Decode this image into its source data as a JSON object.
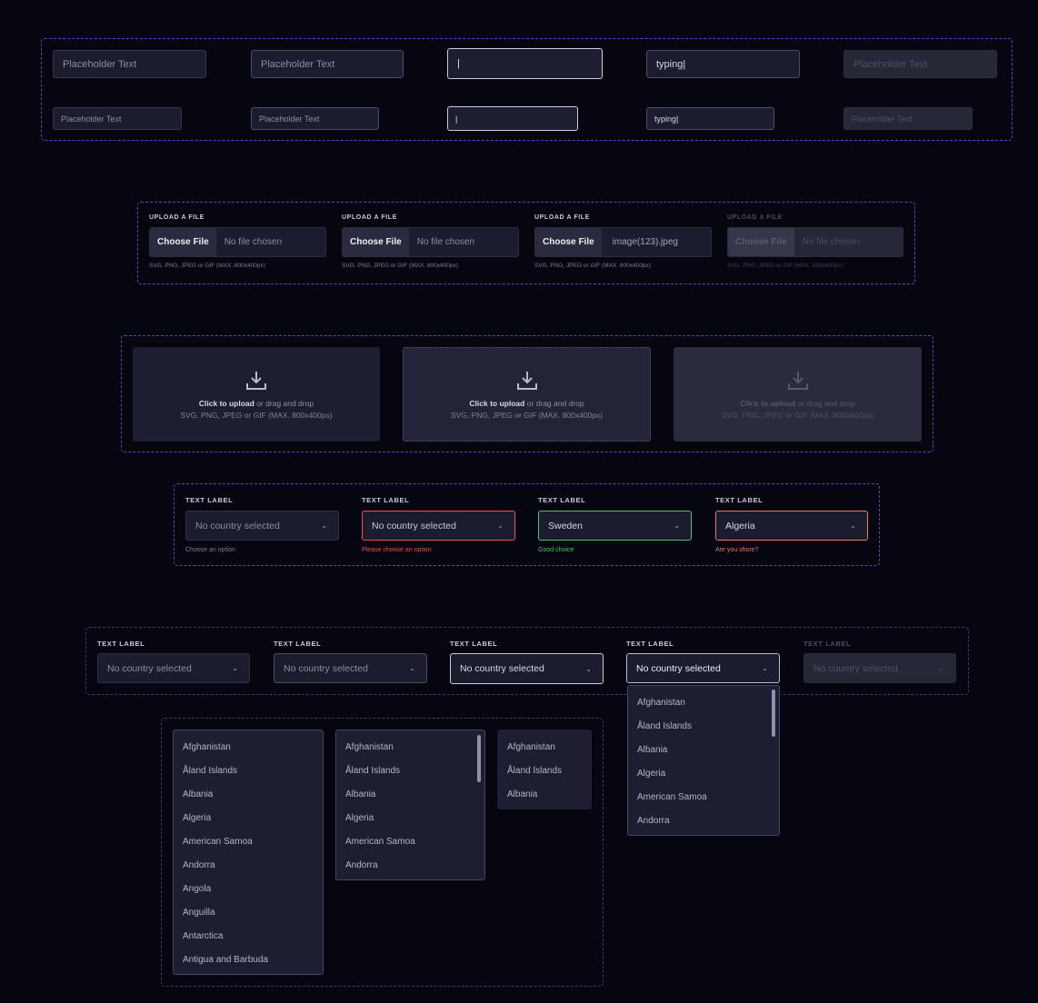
{
  "text_inputs": {
    "large": [
      {
        "value": "Placeholder Text",
        "state": "default"
      },
      {
        "value": "Placeholder Text",
        "state": "bordered"
      },
      {
        "value": "|",
        "state": "focus"
      },
      {
        "value": "typing|",
        "state": "typing"
      },
      {
        "value": "Placeholder Text",
        "state": "disabled"
      }
    ],
    "small": [
      {
        "value": "Placeholder Text",
        "state": "default"
      },
      {
        "value": "Placeholder Text",
        "state": "bordered"
      },
      {
        "value": "|",
        "state": "focus"
      },
      {
        "value": "typing|",
        "state": "typing"
      },
      {
        "value": "Placeholder Text",
        "state": "disabled"
      }
    ]
  },
  "file_uploads": [
    {
      "label": "UPLOAD A FILE",
      "button": "Choose File",
      "file": "No file chosen",
      "hint": "SVG, PNG, JPEG or GIF (MAX. 800x400px)"
    },
    {
      "label": "UPLOAD A FILE",
      "button": "Choose File",
      "file": "No file chosen",
      "hint": "SVG, PNG, JPEG or GIF (MAX. 800x400px)"
    },
    {
      "label": "UPLOAD A FILE",
      "button": "Choose File",
      "file": "image(123).jpeg",
      "hint": "SVG, PNG, JPEG or GIF (MAX. 800x400px)"
    },
    {
      "label": "UPLOAD A FILE",
      "button": "Choose File",
      "file": "No file chosen",
      "hint": "SVG, PNG, JPEG or GIF (MAX. 800x400px)"
    }
  ],
  "dropzones": [
    {
      "strong": "Click to upload",
      "rest": " or drag and drop",
      "hint": "SVG, PNG, JPEG or GIF (MAX. 800x400px)"
    },
    {
      "strong": "Click to upload",
      "rest": " or drag and drop",
      "hint": "SVG, PNG, JPEG or GIF (MAX. 800x400px)"
    },
    {
      "strong": "Click to upload",
      "rest": " or drag and drop",
      "hint": "SVG, PNG, JPEG or GIF (MAX. 800x400px)"
    }
  ],
  "validated_selects": [
    {
      "label": "TEXT LABEL",
      "value": "No country selected",
      "help": "Choose an option"
    },
    {
      "label": "TEXT LABEL",
      "value": "No country selected",
      "help": "Please choose an option"
    },
    {
      "label": "TEXT LABEL",
      "value": "Sweden",
      "help": "Good choice"
    },
    {
      "label": "TEXT LABEL",
      "value": "Algeria",
      "help": "Are you shore?"
    }
  ],
  "state_selects": [
    {
      "label": "TEXT LABEL",
      "value": "No country selected"
    },
    {
      "label": "TEXT LABEL",
      "value": "No country selected"
    },
    {
      "label": "TEXT LABEL",
      "value": "No country selected"
    },
    {
      "label": "TEXT LABEL",
      "value": "No country selected"
    },
    {
      "label": "TEXT LABEL",
      "value": "No country selected"
    }
  ],
  "dropdown_options": {
    "open_select": [
      "Afghanistan",
      "Åland Islands",
      "Albania",
      "Algeria",
      "American Samoa",
      "Andorra"
    ],
    "long_list": [
      "Afghanistan",
      "Åland Islands",
      "Albania",
      "Algeria",
      "American Samoa",
      "Andorra",
      "Angola",
      "Anguilla",
      "Antarctica",
      "Antigua and Barbuda"
    ],
    "scroll_list": [
      "Afghanistan",
      "Åland Islands",
      "Albania",
      "Algeria",
      "American Samoa",
      "Andorra"
    ],
    "short_list": [
      "Afghanistan",
      "Åland Islands",
      "Albania"
    ]
  },
  "icons": {
    "chevron": "chevron-down-icon",
    "upload": "download-tray-icon"
  }
}
